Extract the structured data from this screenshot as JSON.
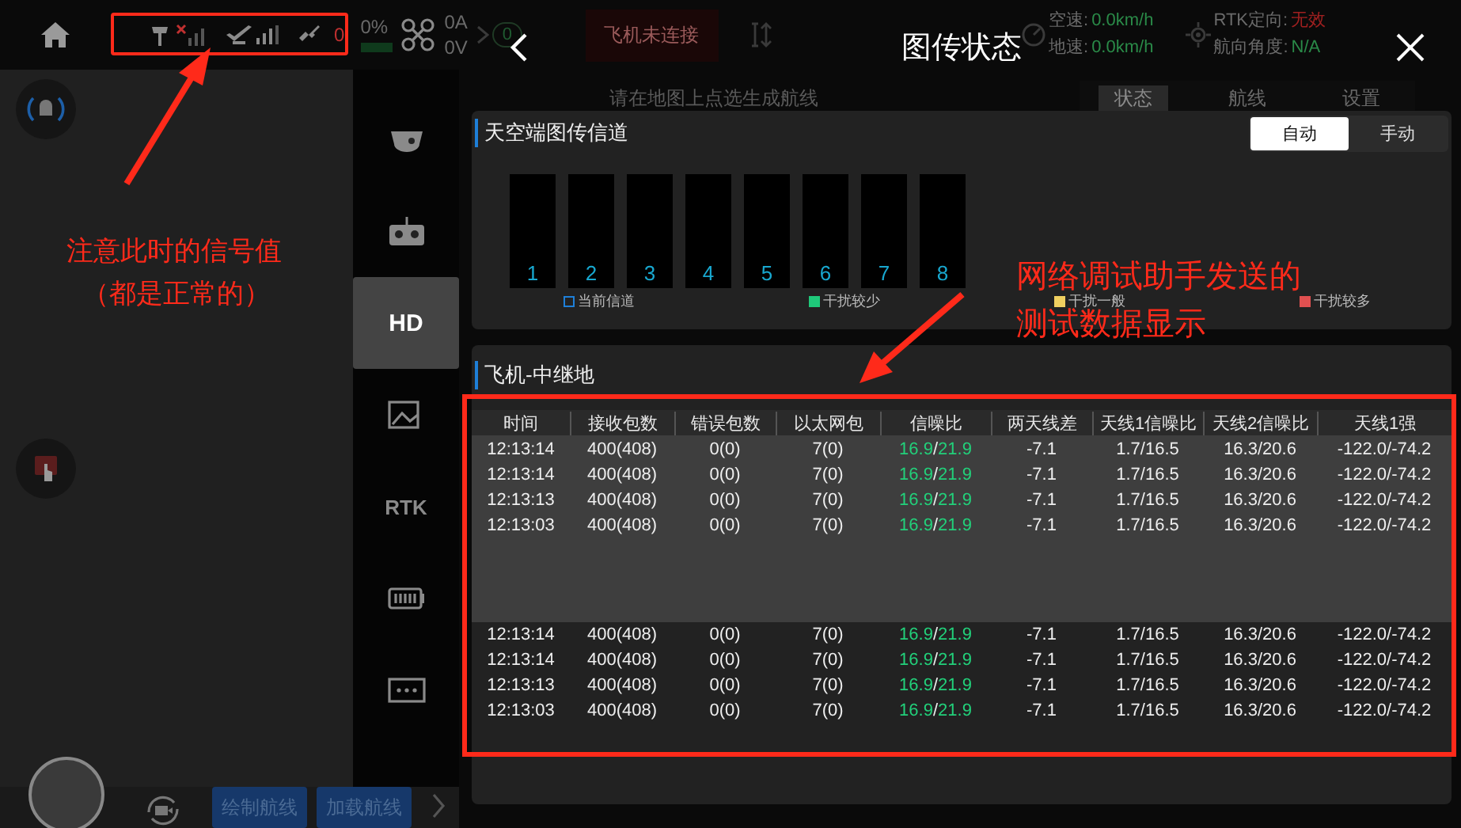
{
  "status_bar": {
    "satellite_count": "0",
    "battery_percent": "0%",
    "current": "0A",
    "voltage": "0V",
    "link_count": "0",
    "connection": "飞机未连接",
    "telemetry": [
      {
        "label": "空速:",
        "value": "0.0km/h",
        "alert": false
      },
      {
        "label": "地速:",
        "value": "0.0km/h",
        "alert": false
      },
      {
        "label": "RTK定向:",
        "value": "无效",
        "alert": true
      },
      {
        "label": "航向角度:",
        "value": "N/A",
        "alert": false
      }
    ]
  },
  "sidebar": {
    "items": [
      {
        "kind": "icon",
        "selected": false
      },
      {
        "kind": "icon",
        "selected": false
      },
      {
        "kind": "text",
        "label": "HD",
        "selected": true
      },
      {
        "kind": "icon",
        "selected": false
      },
      {
        "kind": "text",
        "label": "RTK",
        "selected": false
      },
      {
        "kind": "icon",
        "selected": false
      },
      {
        "kind": "icon",
        "selected": false
      }
    ]
  },
  "map": {
    "hint": "请在地图上点选生成航线",
    "tabs": [
      {
        "label": "状态",
        "selected": true
      },
      {
        "label": "航线",
        "selected": false
      },
      {
        "label": "设置",
        "selected": false
      }
    ]
  },
  "bottom_bar": {
    "buttons": [
      "绘制航线",
      "加载航线"
    ]
  },
  "panel": {
    "title": "图传状态",
    "channel_card": {
      "title": "天空端图传信道",
      "modes": [
        {
          "label": "自动",
          "selected": true
        },
        {
          "label": "手动",
          "selected": false
        }
      ],
      "channels": [
        "1",
        "2",
        "3",
        "4",
        "5",
        "6",
        "7",
        "8"
      ],
      "legend": [
        {
          "label": "当前信道",
          "kind": "outline",
          "color": "#1e7fd8"
        },
        {
          "label": "干扰较少",
          "kind": "fill",
          "color": "#1fc97a"
        },
        {
          "label": "干扰一般",
          "kind": "fill",
          "color": "#f0d060"
        },
        {
          "label": "干扰较多",
          "kind": "fill",
          "color": "#e05050"
        }
      ]
    },
    "table": {
      "title": "飞机-中继地",
      "columns": [
        "时间",
        "接收包数",
        "错误包数",
        "以太网包",
        "信噪比",
        "两天线差",
        "天线1信噪比",
        "天线2信噪比",
        "天线1强"
      ],
      "row_groups": [
        {
          "highlighted": true,
          "rows": [
            {
              "time": "12:13:14",
              "received": "400(408)",
              "errors": "0(0)",
              "ethernet": "7(0)",
              "snr": [
                {
                  "text": "16.9",
                  "good": true
                },
                {
                  "text": "/",
                  "good": false
                },
                {
                  "text": "21.9",
                  "good": true
                }
              ],
              "antenna_diff": "-7.1",
              "antenna1_snr": "1.7/16.5",
              "antenna2_snr": "16.3/20.6",
              "column_9": "-122.0/-74.2"
            },
            {
              "time": "12:13:14",
              "received": "400(408)",
              "errors": "0(0)",
              "ethernet": "7(0)",
              "snr": [
                {
                  "text": "16.9",
                  "good": true
                },
                {
                  "text": "/",
                  "good": false
                },
                {
                  "text": "21.9",
                  "good": true
                }
              ],
              "antenna_diff": "-7.1",
              "antenna1_snr": "1.7/16.5",
              "antenna2_snr": "16.3/20.6",
              "column_9": "-122.0/-74.2"
            },
            {
              "time": "12:13:13",
              "received": "400(408)",
              "errors": "0(0)",
              "ethernet": "7(0)",
              "snr": [
                {
                  "text": "16.9",
                  "good": true
                },
                {
                  "text": "/",
                  "good": false
                },
                {
                  "text": "21.9",
                  "good": true
                }
              ],
              "antenna_diff": "-7.1",
              "antenna1_snr": "1.7/16.5",
              "antenna2_snr": "16.3/20.6",
              "column_9": "-122.0/-74.2"
            },
            {
              "time": "12:13:03",
              "received": "400(408)",
              "errors": "0(0)",
              "ethernet": "7(0)",
              "snr": [
                {
                  "text": "16.9",
                  "good": true
                },
                {
                  "text": "/",
                  "good": false
                },
                {
                  "text": "21.9",
                  "good": true
                }
              ],
              "antenna_diff": "-7.1",
              "antenna1_snr": "1.7/16.5",
              "antenna2_snr": "16.3/20.6",
              "column_9": "-122.0/-74.2"
            }
          ]
        },
        {
          "highlighted": false,
          "rows": [
            {
              "time": "12:13:14",
              "received": "400(408)",
              "errors": "0(0)",
              "ethernet": "7(0)",
              "snr": [
                {
                  "text": "16.9",
                  "good": true
                },
                {
                  "text": "/",
                  "good": false
                },
                {
                  "text": "21.9",
                  "good": true
                }
              ],
              "antenna_diff": "-7.1",
              "antenna1_snr": "1.7/16.5",
              "antenna2_snr": "16.3/20.6",
              "column_9": "-122.0/-74.2"
            },
            {
              "time": "12:13:14",
              "received": "400(408)",
              "errors": "0(0)",
              "ethernet": "7(0)",
              "snr": [
                {
                  "text": "16.9",
                  "good": true
                },
                {
                  "text": "/",
                  "good": false
                },
                {
                  "text": "21.9",
                  "good": true
                }
              ],
              "antenna_diff": "-7.1",
              "antenna1_snr": "1.7/16.5",
              "antenna2_snr": "16.3/20.6",
              "column_9": "-122.0/-74.2"
            },
            {
              "time": "12:13:13",
              "received": "400(408)",
              "errors": "0(0)",
              "ethernet": "7(0)",
              "snr": [
                {
                  "text": "16.9",
                  "good": true
                },
                {
                  "text": "/",
                  "good": false
                },
                {
                  "text": "21.9",
                  "good": true
                }
              ],
              "antenna_diff": "-7.1",
              "antenna1_snr": "1.7/16.5",
              "antenna2_snr": "16.3/20.6",
              "column_9": "-122.0/-74.2"
            },
            {
              "time": "12:13:03",
              "received": "400(408)",
              "errors": "0(0)",
              "ethernet": "7(0)",
              "snr": [
                {
                  "text": "16.9",
                  "good": true
                },
                {
                  "text": "/",
                  "good": false
                },
                {
                  "text": "21.9",
                  "good": true
                }
              ],
              "antenna_diff": "-7.1",
              "antenna1_snr": "1.7/16.5",
              "antenna2_snr": "16.3/20.6",
              "column_9": "-122.0/-74.2"
            }
          ]
        }
      ]
    }
  },
  "annotations": {
    "notes": [
      {
        "lines": [
          "注意此时的信号值",
          "（都是正常的）"
        ]
      },
      {
        "lines": [
          "网络调试助手发送的",
          "测试数据显示"
        ]
      }
    ]
  }
}
